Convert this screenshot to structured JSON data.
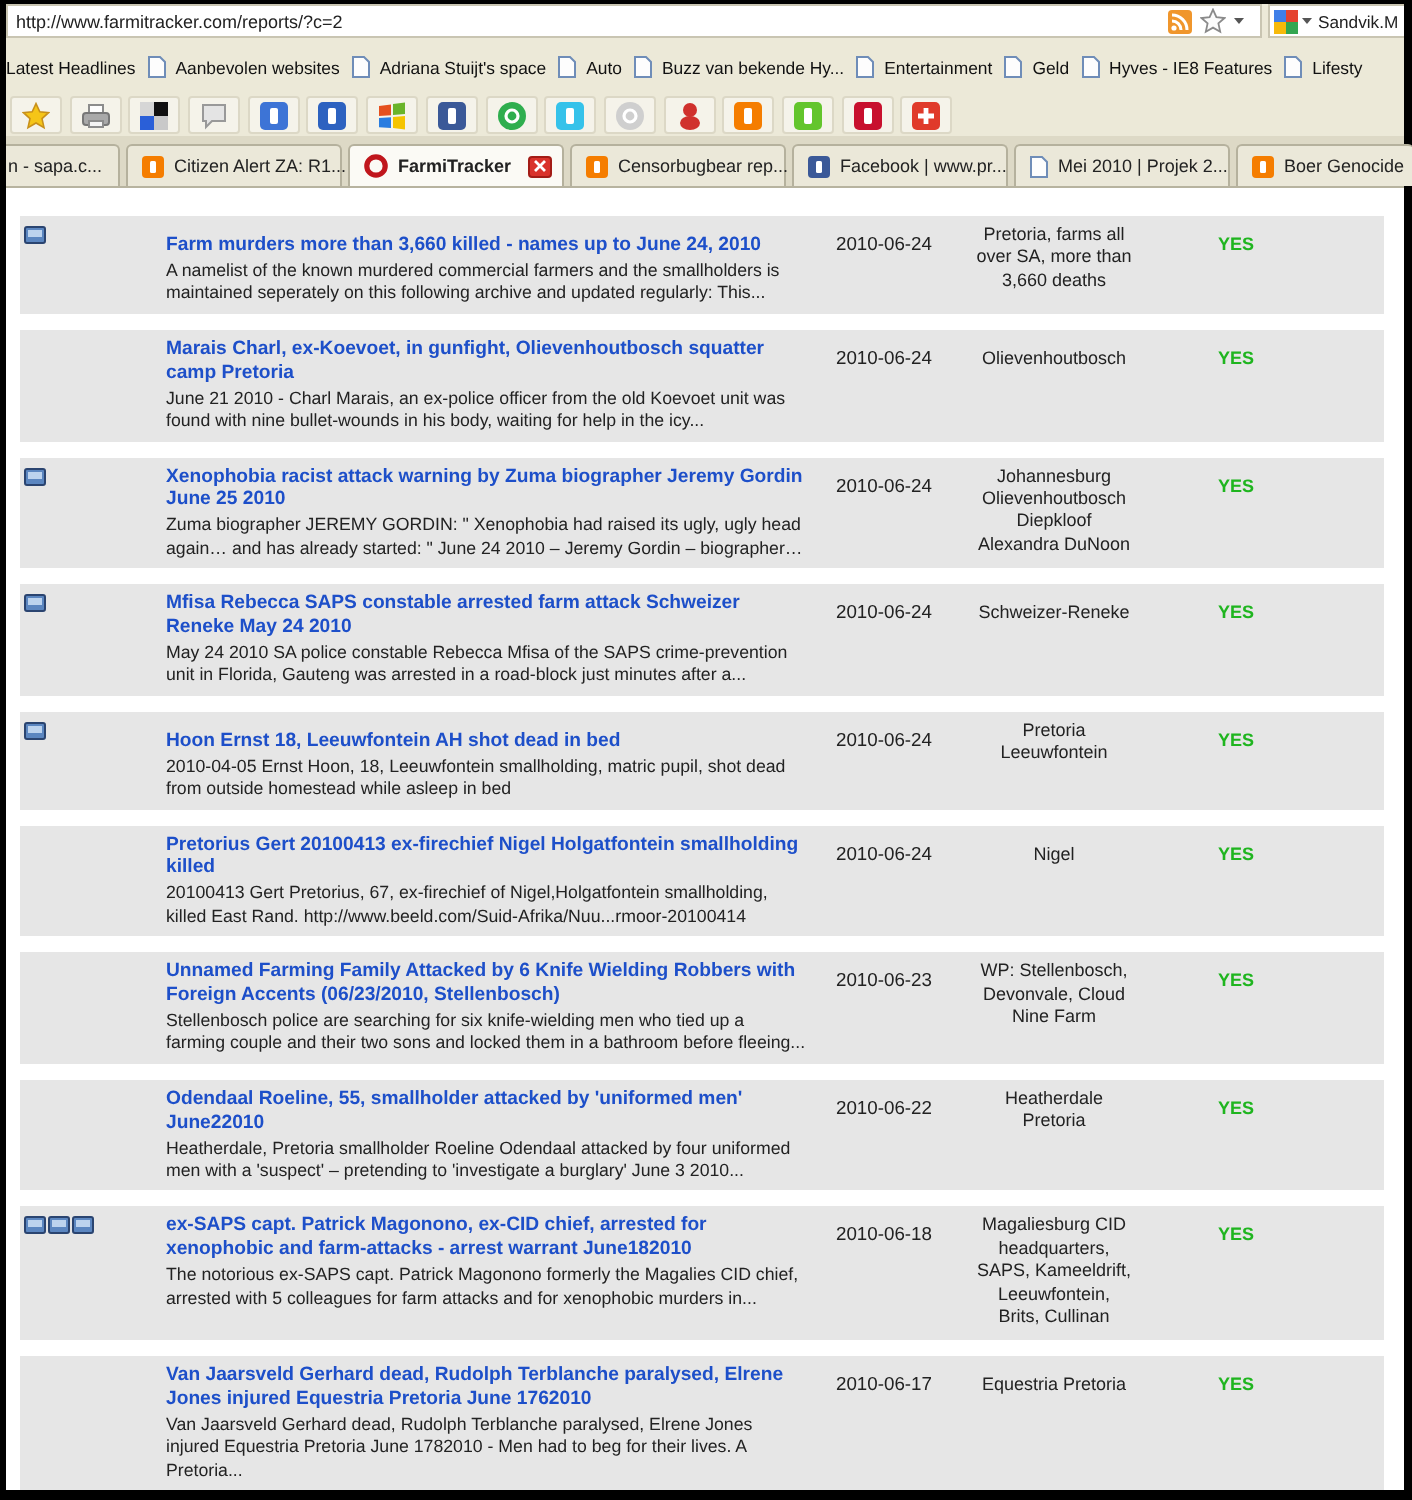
{
  "address_bar": {
    "url": "http://www.farmitracker.com/reports/?c=2"
  },
  "search_box": {
    "value": "Sandvik.M"
  },
  "bookmarks": [
    {
      "label": "Latest Headlines",
      "kind": "text"
    },
    {
      "label": "Aanbevolen websites",
      "kind": "page"
    },
    {
      "label": "Adriana Stuijt's space",
      "kind": "page"
    },
    {
      "label": "Auto",
      "kind": "page"
    },
    {
      "label": "Buzz van bekende Hy...",
      "kind": "page"
    },
    {
      "label": "Entertainment",
      "kind": "page"
    },
    {
      "label": "Geld",
      "kind": "page"
    },
    {
      "label": "Hyves - IE8 Features",
      "kind": "page"
    },
    {
      "label": "Lifesty",
      "kind": "page"
    }
  ],
  "toolbar": [
    {
      "kind": "star"
    },
    {
      "kind": "printer"
    },
    {
      "kind": "squares"
    },
    {
      "kind": "bubble"
    },
    {
      "kind": "tile",
      "color": "#3d74d6"
    },
    {
      "kind": "tile",
      "color": "#2d62c0"
    },
    {
      "kind": "flag"
    },
    {
      "kind": "tile",
      "color": "#3b5998"
    },
    {
      "kind": "circle",
      "color": "#2fae4e"
    },
    {
      "kind": "tile",
      "color": "#35c2ea"
    },
    {
      "kind": "circle",
      "color": "#cfcfcf"
    },
    {
      "kind": "figure"
    },
    {
      "kind": "tile",
      "color": "#f57d00"
    },
    {
      "kind": "tile",
      "color": "#63c52c"
    },
    {
      "kind": "tile",
      "color": "#c8102e"
    },
    {
      "kind": "plus"
    }
  ],
  "tabs": [
    {
      "label": "n - sapa.c...",
      "selected": false
    },
    {
      "label": "Citizen Alert ZA: R1...",
      "selected": false,
      "icon": {
        "kind": "tile",
        "color": "#f57d00"
      }
    },
    {
      "label": "FarmiTracker",
      "selected": true,
      "icon": {
        "kind": "ring",
        "color": "#c0161c"
      }
    },
    {
      "label": "Censorbugbear rep...",
      "selected": false,
      "icon": {
        "kind": "tile",
        "color": "#f57d00"
      }
    },
    {
      "label": "Facebook | www.pr...",
      "selected": false,
      "icon": {
        "kind": "tile",
        "color": "#3b5998"
      }
    },
    {
      "label": "Mei 2010 | Projek 2...",
      "selected": false,
      "icon": {
        "kind": "page"
      }
    },
    {
      "label": "Boer Genocide",
      "selected": false,
      "icon": {
        "kind": "tile",
        "color": "#f57d00"
      }
    }
  ],
  "reports": [
    {
      "images": [
        {
          "kind": "picture"
        }
      ],
      "title": "Farm murders more than 3,660 killed - names up to June 24, 2010",
      "summary": "A namelist of the known murdered commercial farmers and the smallholders is maintained seperately on this following archive and updated regularly: This...",
      "date": "2010-06-24",
      "location_lines": [
        "Pretoria, farms all",
        "over SA, more than",
        "3,660 deaths"
      ],
      "status": "YES"
    },
    {
      "title": "Marais Charl, ex-Koevoet, in gunfight, Olievenhoutbosch squatter camp Pretoria",
      "summary": "June 21 2010 - Charl Marais, an ex-police officer from the old Koevoet unit was found with nine bullet-wounds in his body, waiting for help in the icy...",
      "date": "2010-06-24",
      "location_lines": [
        "Olievenhoutbosch"
      ],
      "status": "YES"
    },
    {
      "images": [
        {
          "kind": "picture"
        }
      ],
      "title": "Xenophobia racist attack warning by Zuma biographer Jeremy Gordin June 25 2010",
      "summary": "Zuma biographer JEREMY GORDIN: \" Xenophobia had raised its ugly, ugly head again… and has already started: \" June 24 2010 – Jeremy Gordin – biographer…",
      "date": "2010-06-24",
      "location_lines": [
        "Johannesburg",
        "Olievenhoutbosch",
        "Diepkloof",
        "Alexandra DuNoon"
      ],
      "status": "YES"
    },
    {
      "images": [
        {
          "kind": "picture"
        }
      ],
      "title": "Mfisa Rebecca SAPS constable arrested farm attack Schweizer Reneke May 24 2010",
      "summary": "May 24 2010 SA police constable Rebecca Mfisa of the SAPS crime-prevention unit in Florida, Gauteng was arrested in a road-block just minutes after a...",
      "date": "2010-06-24",
      "location_lines": [
        "Schweizer-Reneke"
      ],
      "status": "YES"
    },
    {
      "images": [
        {
          "kind": "picture"
        }
      ],
      "title": "Hoon Ernst 18, Leeuwfontein AH shot dead in bed",
      "summary": "2010-04-05 Ernst Hoon, 18, Leeuwfontein smallholding, matric pupil, shot dead from outside homestead while asleep in bed",
      "date": "2010-06-24",
      "location_lines": [
        "Pretoria",
        "Leeuwfontein"
      ],
      "status": "YES"
    },
    {
      "title": "Pretorius Gert 20100413 ex-firechief Nigel Holgatfontein smallholding killed",
      "summary": "20100413 Gert Pretorius, 67, ex-firechief of Nigel,Holgatfontein smallholding, killed East Rand. http://www.beeld.com/Suid-Afrika/Nuu...rmoor-20100414",
      "date": "2010-06-24",
      "location_lines": [
        "Nigel"
      ],
      "status": "YES"
    },
    {
      "title": "Unnamed Farming Family Attacked by 6 Knife Wielding Robbers with Foreign Accents (06/23/2010, Stellenbosch)",
      "summary": "Stellenbosch police are searching for six knife-wielding men who tied up a farming couple and their two sons and locked them in a bathroom before fleeing...",
      "date": "2010-06-23",
      "location_lines": [
        "WP: Stellenbosch,",
        "Devonvale, Cloud",
        "Nine Farm"
      ],
      "status": "YES"
    },
    {
      "title": "Odendaal Roeline, 55, smallholder attacked by 'uniformed men' June22010",
      "summary": "Heatherdale, Pretoria smallholder Roeline Odendaal attacked by four uniformed men with a 'suspect' – pretending to 'investigate a burglary' June 3 2010...",
      "date": "2010-06-22",
      "location_lines": [
        "Heatherdale",
        "Pretoria"
      ],
      "status": "YES"
    },
    {
      "images": [
        {
          "kind": "picture"
        },
        {
          "kind": "picture"
        },
        {
          "kind": "picture"
        }
      ],
      "title": "ex-SAPS capt. Patrick Magonono, ex-CID chief, arrested for xenophobic and farm-attacks - arrest warrant June182010",
      "summary": "The notorious ex-SAPS capt. Patrick Magonono formerly the Magalies CID chief, arrested with 5 colleagues for farm attacks and for xenophobic murders in...",
      "date": "2010-06-18",
      "location_lines": [
        "Magaliesburg CID",
        "headquarters,",
        "SAPS, Kameeldrift,",
        "Leeuwfontein,",
        "Brits, Cullinan"
      ],
      "status": "YES"
    },
    {
      "title": "Van Jaarsveld Gerhard dead, Rudolph Terblanche paralysed, Elrene Jones injured Equestria Pretoria June 1762010",
      "summary": "Van Jaarsveld Gerhard dead, Rudolph Terblanche paralysed, Elrene Jones injured Equestria Pretoria June 1782010 - Men had to beg for their lives. A Pretoria...",
      "date": "2010-06-17",
      "location_lines": [
        "Equestria Pretoria"
      ],
      "status": "YES"
    }
  ]
}
